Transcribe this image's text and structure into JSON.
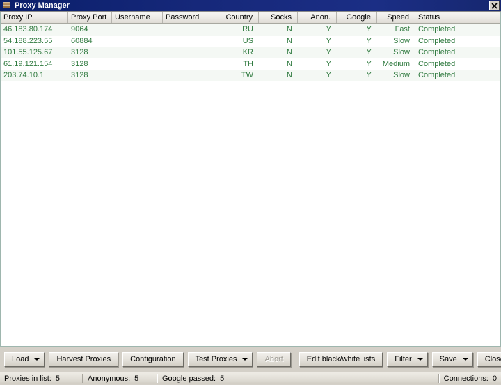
{
  "window": {
    "title": "Proxy Manager",
    "icon": "globe-icon",
    "close_label": "x"
  },
  "table": {
    "columns": [
      {
        "key": "ip",
        "label": "Proxy IP",
        "align": "left"
      },
      {
        "key": "port",
        "label": "Proxy Port",
        "align": "left"
      },
      {
        "key": "username",
        "label": "Username",
        "align": "left"
      },
      {
        "key": "password",
        "label": "Password",
        "align": "left"
      },
      {
        "key": "country",
        "label": "Country",
        "align": "right"
      },
      {
        "key": "socks",
        "label": "Socks",
        "align": "right"
      },
      {
        "key": "anon",
        "label": "Anon.",
        "align": "right"
      },
      {
        "key": "google",
        "label": "Google",
        "align": "right"
      },
      {
        "key": "speed",
        "label": "Speed",
        "align": "right"
      },
      {
        "key": "status",
        "label": "Status",
        "align": "left"
      }
    ],
    "rows": [
      {
        "ip": "46.183.80.174",
        "port": "9064",
        "username": "",
        "password": "",
        "country": "RU",
        "socks": "N",
        "anon": "Y",
        "google": "Y",
        "speed": "Fast",
        "status": "Completed"
      },
      {
        "ip": "54.188.223.55",
        "port": "60884",
        "username": "",
        "password": "",
        "country": "US",
        "socks": "N",
        "anon": "Y",
        "google": "Y",
        "speed": "Slow",
        "status": "Completed"
      },
      {
        "ip": "101.55.125.67",
        "port": "3128",
        "username": "",
        "password": "",
        "country": "KR",
        "socks": "N",
        "anon": "Y",
        "google": "Y",
        "speed": "Slow",
        "status": "Completed"
      },
      {
        "ip": "61.19.121.154",
        "port": "3128",
        "username": "",
        "password": "",
        "country": "TH",
        "socks": "N",
        "anon": "Y",
        "google": "Y",
        "speed": "Medium",
        "status": "Completed"
      },
      {
        "ip": "203.74.10.1",
        "port": "3128",
        "username": "",
        "password": "",
        "country": "TW",
        "socks": "N",
        "anon": "Y",
        "google": "Y",
        "speed": "Slow",
        "status": "Completed"
      }
    ],
    "row_text_color": "#2f7a3f"
  },
  "toolbar": {
    "load_label": "Load",
    "harvest_label": "Harvest Proxies",
    "configuration_label": "Configuration",
    "test_proxies_label": "Test Proxies",
    "abort_label": "Abort",
    "edit_lists_label": "Edit black/white lists",
    "filter_label": "Filter",
    "save_label": "Save",
    "close_label": "Close"
  },
  "statusbar": {
    "proxies_in_list_label": "Proxies in list:",
    "proxies_in_list_value": "5",
    "anonymous_label": "Anonymous:",
    "anonymous_value": "5",
    "google_passed_label": "Google passed:",
    "google_passed_value": "5",
    "connections_label": "Connections:",
    "connections_value": "0"
  }
}
